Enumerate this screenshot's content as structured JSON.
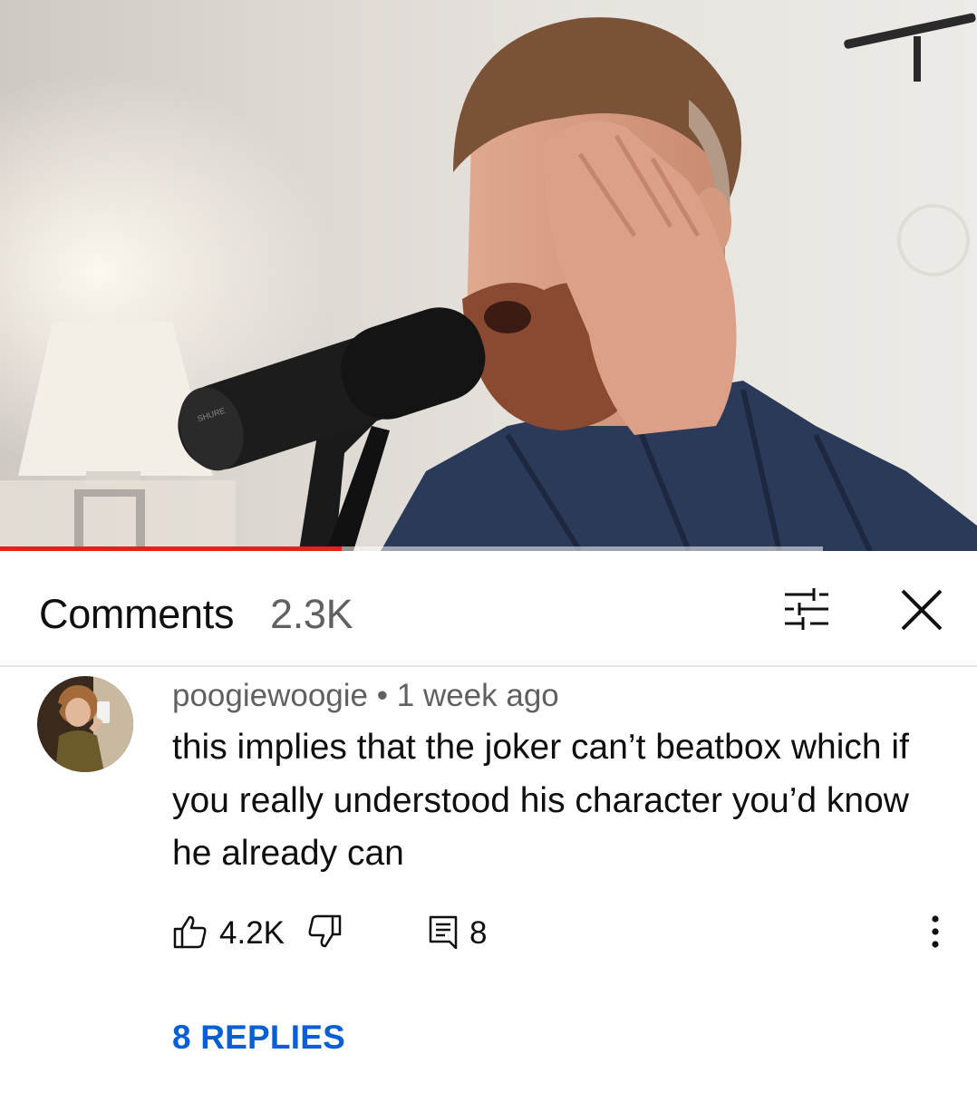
{
  "video": {
    "progress_fraction": 0.35,
    "buffered_fraction": 0.842
  },
  "comments_header": {
    "title": "Comments",
    "count": "2.3K",
    "filter_icon": "sort-filter-icon",
    "close_icon": "close-icon"
  },
  "comment": {
    "author": "poogiewoogie",
    "separator": "•",
    "timestamp": "1 week ago",
    "text": "this implies that the joker can’t beatbox which if you really understood his character you’d know he already can",
    "likes": "4.2K",
    "reply_count": "8",
    "replies_link": "8 REPLIES",
    "like_icon": "thumbs-up-icon",
    "dislike_icon": "thumbs-down-icon",
    "reply_icon": "reply-comment-icon",
    "more_icon": "more-vertical-icon"
  },
  "colors": {
    "progress": "#e62117",
    "link": "#065fd4",
    "secondary_text": "#606060"
  }
}
